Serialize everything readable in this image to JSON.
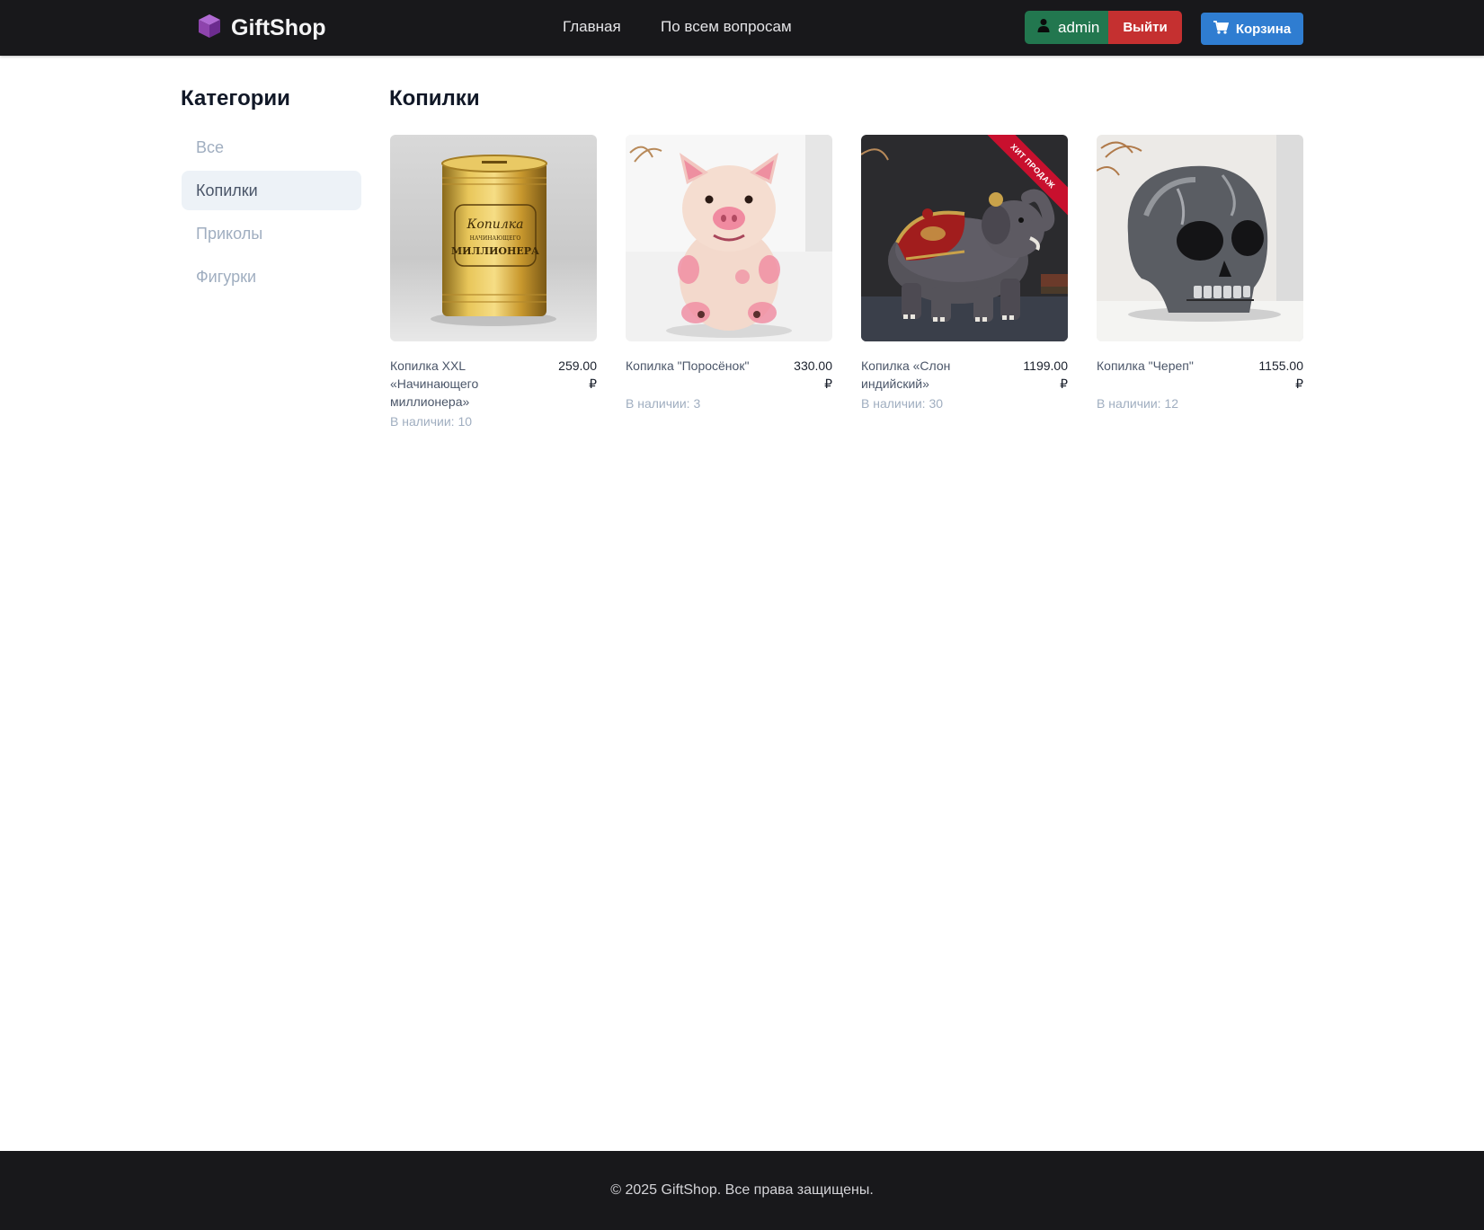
{
  "header": {
    "brand": "GiftShop",
    "nav": [
      {
        "label": "Главная"
      },
      {
        "label": "По всем вопросам"
      }
    ],
    "user": {
      "name": "admin",
      "logout_label": "Выйти"
    },
    "cart_label": "Корзина"
  },
  "sidebar": {
    "title": "Категории",
    "items": [
      {
        "label": "Все",
        "active": false
      },
      {
        "label": "Копилки",
        "active": true
      },
      {
        "label": "Приколы",
        "active": false
      },
      {
        "label": "Фигурки",
        "active": false
      }
    ]
  },
  "main": {
    "title": "Копилки",
    "products": [
      {
        "name": "Копилка XXL «Начинающего миллионера»",
        "price": "259.00 ₽",
        "stock": "В наличии: 10",
        "image": "golden-can-bank",
        "can_label_top": "Копилка",
        "can_label_mid": "НАЧИНАЮЩЕГО",
        "can_label_bottom": "МИЛЛИОНЕРА"
      },
      {
        "name": "Копилка \"Поросёнок\"",
        "price": "330.00 ₽",
        "stock": "В наличии: 3",
        "image": "pig-bank"
      },
      {
        "name": "Копилка «Слон индийский»",
        "price": "1199.00 ₽",
        "stock": "В наличии: 30",
        "image": "elephant-bank",
        "badge": "ХИТ ПРОДАЖ"
      },
      {
        "name": "Копилка \"Череп\"",
        "price": "1155.00 ₽",
        "stock": "В наличии: 12",
        "image": "skull-bank"
      }
    ]
  },
  "footer": {
    "text": "© 2025 GiftShop. Все права защищены."
  },
  "colors": {
    "header_bg": "#18181b",
    "user_chip": "#22774f",
    "logout": "#c53030",
    "cart": "#2f7dd1",
    "brand_cube": "#8e44ad"
  }
}
